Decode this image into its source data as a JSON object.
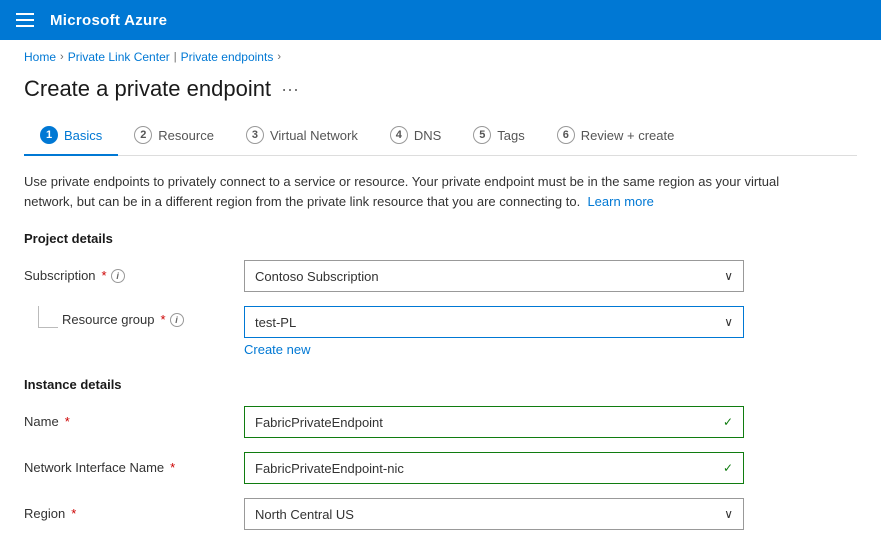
{
  "topbar": {
    "title": "Microsoft Azure"
  },
  "breadcrumb": {
    "home": "Home",
    "link_center": "Private Link Center",
    "separator": ">",
    "private_endpoints": "Private endpoints"
  },
  "page": {
    "title": "Create a private endpoint",
    "ellipsis": "···"
  },
  "tabs": [
    {
      "num": "1",
      "label": "Basics",
      "active": true
    },
    {
      "num": "2",
      "label": "Resource",
      "active": false
    },
    {
      "num": "3",
      "label": "Virtual Network",
      "active": false
    },
    {
      "num": "4",
      "label": "DNS",
      "active": false
    },
    {
      "num": "5",
      "label": "Tags",
      "active": false
    },
    {
      "num": "6",
      "label": "Review + create",
      "active": false
    }
  ],
  "info_text": "Use private endpoints to privately connect to a service or resource. Your private endpoint must be in the same region as your virtual network, but can be in a different region from the private link resource that you are connecting to.",
  "learn_more": "Learn more",
  "project_details": {
    "heading": "Project details",
    "subscription_label": "Subscription",
    "subscription_value": "Contoso Subscription",
    "resource_group_label": "Resource group",
    "resource_group_value": "test-PL",
    "create_new": "Create new"
  },
  "instance_details": {
    "heading": "Instance details",
    "name_label": "Name",
    "name_value": "FabricPrivateEndpoint",
    "nic_label": "Network Interface Name",
    "nic_value": "FabricPrivateEndpoint-nic",
    "region_label": "Region",
    "region_value": "North Central US"
  },
  "icons": {
    "info": "i",
    "chevron_down": "∨",
    "check": "✓"
  }
}
